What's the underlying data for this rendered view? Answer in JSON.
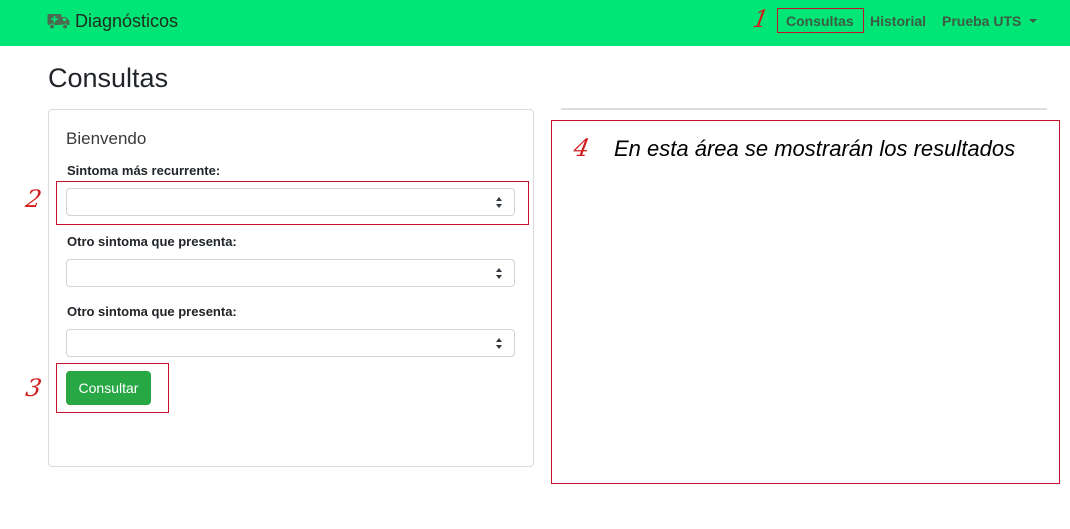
{
  "navbar": {
    "brand_icon": "ambulance-icon",
    "brand": "Diagnósticos",
    "links": [
      "Consultas",
      "Historial"
    ],
    "user_menu": "Prueba UTS",
    "color": "#00e676"
  },
  "page_title": "Consultas",
  "form": {
    "title": "Bienvendo",
    "fields": [
      {
        "label": "Sintoma más recurrente:",
        "value": ""
      },
      {
        "label": "Otro sintoma que presenta:",
        "value": ""
      },
      {
        "label": "Otro sintoma que presenta:",
        "value": ""
      }
    ],
    "submit_label": "Consultar",
    "submit_color": "#28a745"
  },
  "results": {
    "placeholder": "En esta área se mostrarán los resultados"
  },
  "annotations": {
    "marks": [
      "1",
      "2",
      "3",
      "4"
    ],
    "color": "#c8102e"
  }
}
